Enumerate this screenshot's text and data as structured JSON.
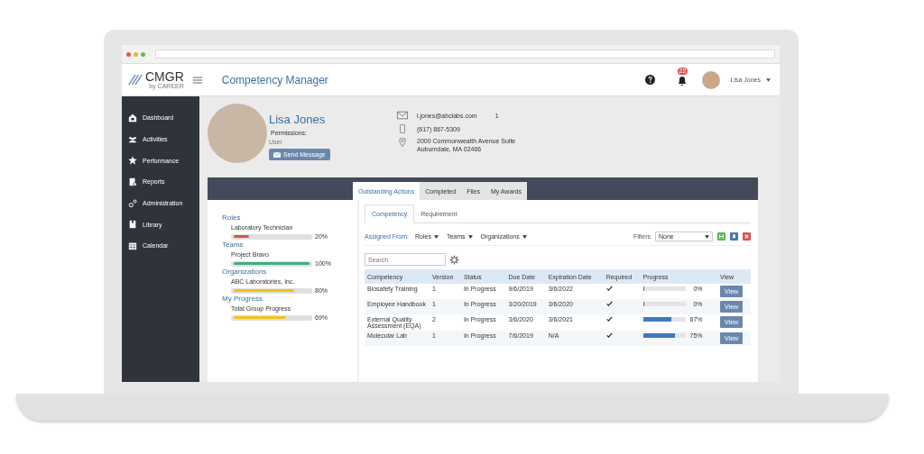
{
  "header": {
    "logo": "CMGR",
    "logo_sub": "by CAREER",
    "title": "Competency Manager",
    "notification_count": "22",
    "user_name": "Lisa Jones"
  },
  "sidebar": {
    "items": [
      {
        "label": "Dashboard"
      },
      {
        "label": "Activities"
      },
      {
        "label": "Performance"
      },
      {
        "label": "Reports"
      },
      {
        "label": "Administration"
      },
      {
        "label": "Library"
      },
      {
        "label": "Calendar"
      }
    ]
  },
  "profile": {
    "name": "Lisa Jones",
    "permissions_label": "Permissions:",
    "role": "User",
    "send_button": "Send Message",
    "email": "l.jones@abclabs.com",
    "email_note": "1",
    "phone": "(617) 867-5309",
    "address_line_1": "2000 Commonwealth Avenue Suite",
    "address_line_2": "Auburndale, MA 02466"
  },
  "summary": [
    {
      "heading": "Roles",
      "item": "Laboratory Technician",
      "level": 0.2,
      "reading": "20%",
      "color": "#d9534f"
    },
    {
      "heading": "Teams",
      "item": "Project Bravo",
      "level": 1.0,
      "reading": "100%",
      "color": "#3fae7f"
    },
    {
      "heading": "Organizations",
      "item": "ABC Laboratories, Inc.",
      "level": 0.8,
      "reading": "80%",
      "color": "#f0c419"
    },
    {
      "heading": "My Progress",
      "item": "Total Group Progress",
      "level": 0.69,
      "reading": "69%",
      "color": "#f0c419"
    }
  ],
  "tabs": [
    {
      "label": "Outstanding Actions",
      "selected": true
    },
    {
      "label": "Completed",
      "selected": false
    },
    {
      "label": "Files",
      "selected": false
    },
    {
      "label": "My Awards",
      "selected": false
    }
  ],
  "subtabs": [
    {
      "label": "Competency",
      "selected": true
    },
    {
      "label": "Requirement",
      "selected": false
    }
  ],
  "filter_bar": {
    "assigned_from": "Assigned From:",
    "dropdowns": [
      "Roles",
      "Teams",
      "Organizations"
    ],
    "filters_label": "Filters",
    "filters_value": "None"
  },
  "search": {
    "placeholder": "Search"
  },
  "table": {
    "columns": [
      "Competency",
      "Version",
      "Status",
      "Due Date",
      "Expiration Date",
      "Required",
      "Progress",
      "View"
    ],
    "rows": [
      {
        "competency": "Biosafety Training",
        "version": "1",
        "status": "In Progress",
        "due": "9/6/2019",
        "expiration": "3/6/2022",
        "required": true,
        "level": 0,
        "reading": "0%",
        "button": "View"
      },
      {
        "competency": "Employee Handbook",
        "version": "1",
        "status": "In Progress",
        "due": "3/20/2019",
        "expiration": "3/6/2020",
        "required": true,
        "level": 0,
        "reading": "0%",
        "button": "View"
      },
      {
        "competency": "External Quality Assessment (EQA)",
        "version": "2",
        "status": "In Progress",
        "due": "3/6/2020",
        "expiration": "3/6/2021",
        "required": true,
        "level": 0.67,
        "reading": "67%",
        "button": "View"
      },
      {
        "competency": "Molecular Lab",
        "version": "1",
        "status": "In Progress",
        "due": "7/6/2019",
        "expiration": "N/A",
        "required": true,
        "level": 0.75,
        "reading": "75%",
        "button": "View"
      }
    ]
  }
}
